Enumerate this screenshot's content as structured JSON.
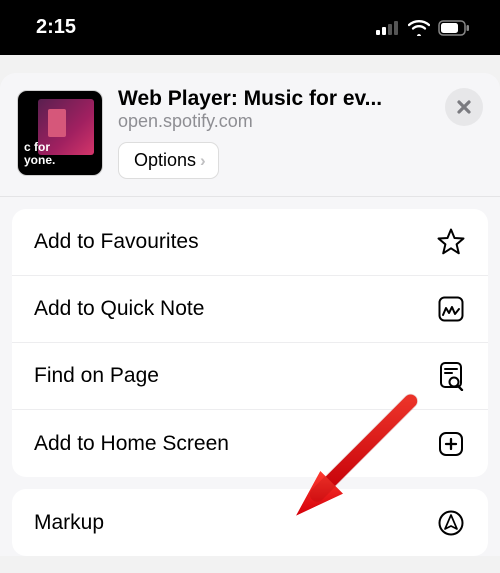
{
  "status_bar": {
    "time": "2:15"
  },
  "sheet": {
    "thumb_line1": "c for",
    "thumb_line2": "yone.",
    "title": "Web Player: Music for ev...",
    "url": "open.spotify.com",
    "options_label": "Options",
    "close_aria": "Close"
  },
  "actions_group_1": [
    {
      "label": "Add to Favourites",
      "icon": "star"
    },
    {
      "label": "Add to Quick Note",
      "icon": "quicknote"
    },
    {
      "label": "Find on Page",
      "icon": "find"
    },
    {
      "label": "Add to Home Screen",
      "icon": "addhome"
    }
  ],
  "actions_group_2": [
    {
      "label": "Markup",
      "icon": "markup"
    }
  ]
}
